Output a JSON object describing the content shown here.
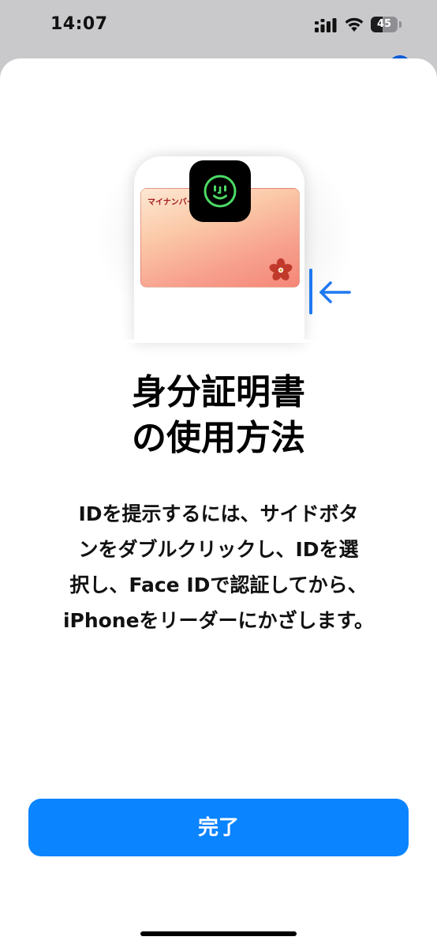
{
  "status_bar": {
    "time": "14:07",
    "battery_level": "45",
    "battery_fraction": 0.45,
    "icons": [
      "cellular-signal-icon",
      "wifi-icon",
      "battery-icon"
    ]
  },
  "illustration": {
    "card_label": "マイナンバー",
    "icons": [
      "face-id-icon",
      "sakura-icon",
      "arrow-left-icon"
    ]
  },
  "title": {
    "line1": "身分証明書",
    "line2": "の使用方法"
  },
  "description": {
    "line1": "IDを提示するには、サイドボタ",
    "line2": "ンをダブルクリックし、IDを選",
    "line3": "択し、Face IDで認証してから、",
    "line4": "iPhoneをリーダーにかざします。"
  },
  "done_button": {
    "label": "完了"
  },
  "colors": {
    "accent": "#0a84ff",
    "side_indicator": "#1f78f0",
    "face_id_green": "#4cd964",
    "card_text": "#a31c1c"
  }
}
